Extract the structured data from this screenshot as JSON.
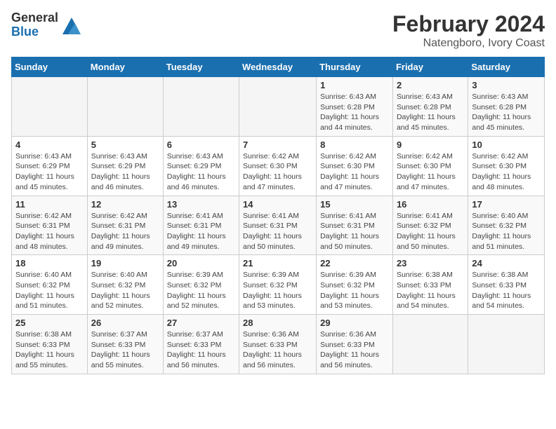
{
  "header": {
    "logo_general": "General",
    "logo_blue": "Blue",
    "title": "February 2024",
    "subtitle": "Natengboro, Ivory Coast"
  },
  "days_of_week": [
    "Sunday",
    "Monday",
    "Tuesday",
    "Wednesday",
    "Thursday",
    "Friday",
    "Saturday"
  ],
  "weeks": [
    [
      {
        "day": "",
        "info": ""
      },
      {
        "day": "",
        "info": ""
      },
      {
        "day": "",
        "info": ""
      },
      {
        "day": "",
        "info": ""
      },
      {
        "day": "1",
        "info": "Sunrise: 6:43 AM\nSunset: 6:28 PM\nDaylight: 11 hours and 44 minutes."
      },
      {
        "day": "2",
        "info": "Sunrise: 6:43 AM\nSunset: 6:28 PM\nDaylight: 11 hours and 45 minutes."
      },
      {
        "day": "3",
        "info": "Sunrise: 6:43 AM\nSunset: 6:28 PM\nDaylight: 11 hours and 45 minutes."
      }
    ],
    [
      {
        "day": "4",
        "info": "Sunrise: 6:43 AM\nSunset: 6:29 PM\nDaylight: 11 hours and 45 minutes."
      },
      {
        "day": "5",
        "info": "Sunrise: 6:43 AM\nSunset: 6:29 PM\nDaylight: 11 hours and 46 minutes."
      },
      {
        "day": "6",
        "info": "Sunrise: 6:43 AM\nSunset: 6:29 PM\nDaylight: 11 hours and 46 minutes."
      },
      {
        "day": "7",
        "info": "Sunrise: 6:42 AM\nSunset: 6:30 PM\nDaylight: 11 hours and 47 minutes."
      },
      {
        "day": "8",
        "info": "Sunrise: 6:42 AM\nSunset: 6:30 PM\nDaylight: 11 hours and 47 minutes."
      },
      {
        "day": "9",
        "info": "Sunrise: 6:42 AM\nSunset: 6:30 PM\nDaylight: 11 hours and 47 minutes."
      },
      {
        "day": "10",
        "info": "Sunrise: 6:42 AM\nSunset: 6:30 PM\nDaylight: 11 hours and 48 minutes."
      }
    ],
    [
      {
        "day": "11",
        "info": "Sunrise: 6:42 AM\nSunset: 6:31 PM\nDaylight: 11 hours and 48 minutes."
      },
      {
        "day": "12",
        "info": "Sunrise: 6:42 AM\nSunset: 6:31 PM\nDaylight: 11 hours and 49 minutes."
      },
      {
        "day": "13",
        "info": "Sunrise: 6:41 AM\nSunset: 6:31 PM\nDaylight: 11 hours and 49 minutes."
      },
      {
        "day": "14",
        "info": "Sunrise: 6:41 AM\nSunset: 6:31 PM\nDaylight: 11 hours and 50 minutes."
      },
      {
        "day": "15",
        "info": "Sunrise: 6:41 AM\nSunset: 6:31 PM\nDaylight: 11 hours and 50 minutes."
      },
      {
        "day": "16",
        "info": "Sunrise: 6:41 AM\nSunset: 6:32 PM\nDaylight: 11 hours and 50 minutes."
      },
      {
        "day": "17",
        "info": "Sunrise: 6:40 AM\nSunset: 6:32 PM\nDaylight: 11 hours and 51 minutes."
      }
    ],
    [
      {
        "day": "18",
        "info": "Sunrise: 6:40 AM\nSunset: 6:32 PM\nDaylight: 11 hours and 51 minutes."
      },
      {
        "day": "19",
        "info": "Sunrise: 6:40 AM\nSunset: 6:32 PM\nDaylight: 11 hours and 52 minutes."
      },
      {
        "day": "20",
        "info": "Sunrise: 6:39 AM\nSunset: 6:32 PM\nDaylight: 11 hours and 52 minutes."
      },
      {
        "day": "21",
        "info": "Sunrise: 6:39 AM\nSunset: 6:32 PM\nDaylight: 11 hours and 53 minutes."
      },
      {
        "day": "22",
        "info": "Sunrise: 6:39 AM\nSunset: 6:32 PM\nDaylight: 11 hours and 53 minutes."
      },
      {
        "day": "23",
        "info": "Sunrise: 6:38 AM\nSunset: 6:33 PM\nDaylight: 11 hours and 54 minutes."
      },
      {
        "day": "24",
        "info": "Sunrise: 6:38 AM\nSunset: 6:33 PM\nDaylight: 11 hours and 54 minutes."
      }
    ],
    [
      {
        "day": "25",
        "info": "Sunrise: 6:38 AM\nSunset: 6:33 PM\nDaylight: 11 hours and 55 minutes."
      },
      {
        "day": "26",
        "info": "Sunrise: 6:37 AM\nSunset: 6:33 PM\nDaylight: 11 hours and 55 minutes."
      },
      {
        "day": "27",
        "info": "Sunrise: 6:37 AM\nSunset: 6:33 PM\nDaylight: 11 hours and 56 minutes."
      },
      {
        "day": "28",
        "info": "Sunrise: 6:36 AM\nSunset: 6:33 PM\nDaylight: 11 hours and 56 minutes."
      },
      {
        "day": "29",
        "info": "Sunrise: 6:36 AM\nSunset: 6:33 PM\nDaylight: 11 hours and 56 minutes."
      },
      {
        "day": "",
        "info": ""
      },
      {
        "day": "",
        "info": ""
      }
    ]
  ]
}
